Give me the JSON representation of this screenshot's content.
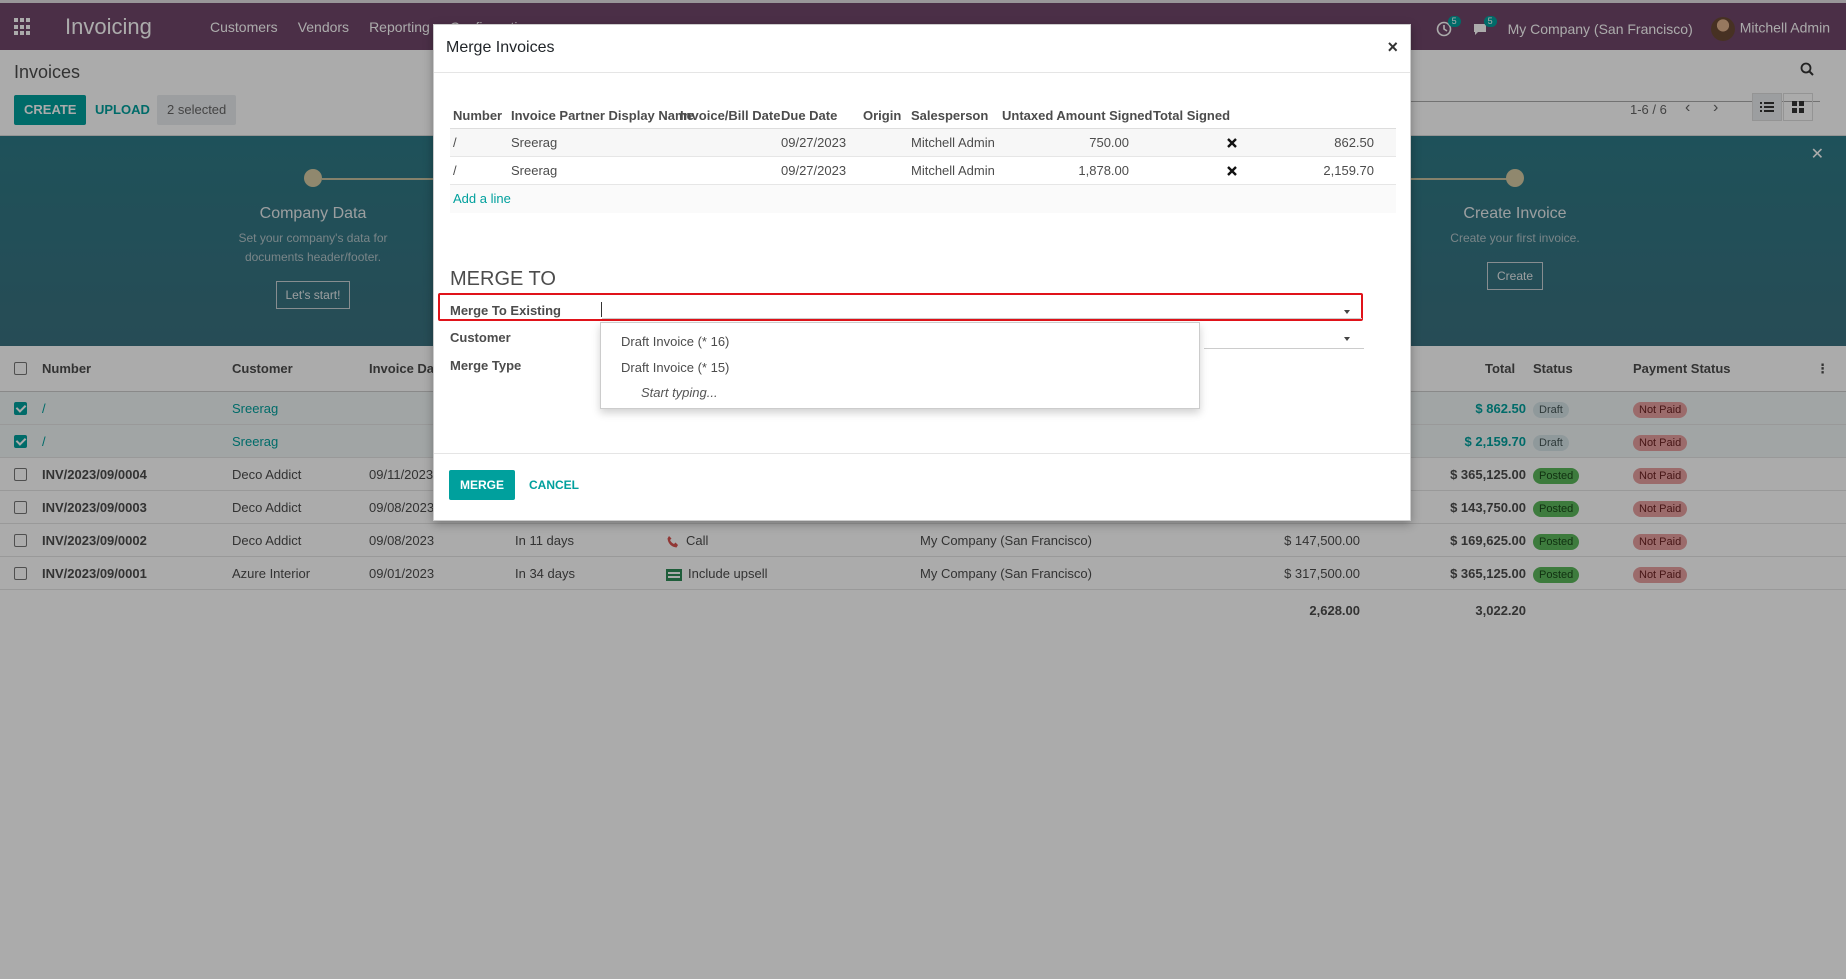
{
  "navbar": {
    "app_title": "Invoicing",
    "menu": [
      "Customers",
      "Vendors",
      "Reporting",
      "Configuration"
    ],
    "activity_count": "5",
    "message_count": "5",
    "company": "My Company (San Francisco)",
    "user": "Mitchell Admin"
  },
  "control": {
    "breadcrumb": "Invoices",
    "create_label": "CREATE",
    "upload_label": "UPLOAD",
    "selected_label": "2 selected",
    "pager": "1-6 / 6"
  },
  "banner": {
    "steps": [
      {
        "title": "Company Data",
        "desc1": "Set your company's data for",
        "desc2": "documents header/footer.",
        "button": "Let's start!"
      },
      {
        "title": "Create Invoice",
        "desc1": "Create your first invoice.",
        "desc2": "",
        "button": "Create"
      }
    ]
  },
  "list": {
    "headers": {
      "number": "Number",
      "customer": "Customer",
      "invoice_date": "Invoice Dat",
      "total": "Total",
      "status": "Status",
      "payment_status": "Payment Status"
    },
    "rows": [
      {
        "number": "/",
        "customer": "Sreerag",
        "invoice_date": "",
        "due": "",
        "activity": "",
        "company": "",
        "untaxed": "",
        "total": "$ 862.50",
        "status": "Draft",
        "payment": "Not Paid",
        "checked": true
      },
      {
        "number": "/",
        "customer": "Sreerag",
        "invoice_date": "",
        "due": "",
        "activity": "",
        "company": "",
        "untaxed": "",
        "total": "$ 2,159.70",
        "status": "Draft",
        "payment": "Not Paid",
        "checked": true
      },
      {
        "number": "INV/2023/09/0004",
        "customer": "Deco Addict",
        "invoice_date": "09/11/2023",
        "due": "",
        "activity": "",
        "company": "",
        "untaxed": "",
        "total": "$ 365,125.00",
        "status": "Posted",
        "payment": "Not Paid",
        "checked": false
      },
      {
        "number": "INV/2023/09/0003",
        "customer": "Deco Addict",
        "invoice_date": "09/08/2023",
        "due": "",
        "activity": "",
        "company": "",
        "untaxed": "",
        "total": "$ 143,750.00",
        "status": "Posted",
        "payment": "Not Paid",
        "checked": false
      },
      {
        "number": "INV/2023/09/0002",
        "customer": "Deco Addict",
        "invoice_date": "09/08/2023",
        "due": "In 11 days",
        "activity": "Call",
        "company": "My Company (San Francisco)",
        "untaxed": "$ 147,500.00",
        "total": "$ 169,625.00",
        "status": "Posted",
        "payment": "Not Paid",
        "checked": false
      },
      {
        "number": "INV/2023/09/0001",
        "customer": "Azure Interior",
        "invoice_date": "09/01/2023",
        "due": "In 34 days",
        "activity": "Include upsell",
        "company": "My Company (San Francisco)",
        "untaxed": "$ 317,500.00",
        "total": "$ 365,125.00",
        "status": "Posted",
        "payment": "Not Paid",
        "checked": false
      }
    ],
    "footer": {
      "untaxed_sum": "2,628.00",
      "total_sum": "3,022.20"
    }
  },
  "modal": {
    "title": "Merge Invoices",
    "close": "×",
    "table_headers": {
      "number": "Number",
      "partner": "Invoice Partner Display Name",
      "date": "Invoice/Bill Date",
      "due": "Due Date",
      "origin": "Origin",
      "salesperson": "Salesperson",
      "untaxed": "Untaxed Amount Signed",
      "total": "Total Signed"
    },
    "lines": [
      {
        "number": "/",
        "partner": "Sreerag",
        "date": "",
        "due": "09/27/2023",
        "origin": "",
        "salesperson": "Mitchell Admin",
        "untaxed": "750.00",
        "total": "862.50"
      },
      {
        "number": "/",
        "partner": "Sreerag",
        "date": "",
        "due": "09/27/2023",
        "origin": "",
        "salesperson": "Mitchell Admin",
        "untaxed": "1,878.00",
        "total": "2,159.70"
      }
    ],
    "add_line": "Add a line",
    "section_title": "MERGE TO",
    "field_merge_existing": "Merge To Existing",
    "field_customer": "Customer",
    "field_merge_type": "Merge Type",
    "dropdown_options": [
      "Draft Invoice (* 16)",
      "Draft Invoice (* 15)"
    ],
    "dropdown_hint": "Start typing...",
    "merge_button": "MERGE",
    "cancel_button": "CANCEL"
  },
  "colors": {
    "brand": "#71466a",
    "accent": "#00a09d",
    "highlight": "#e0131a"
  }
}
